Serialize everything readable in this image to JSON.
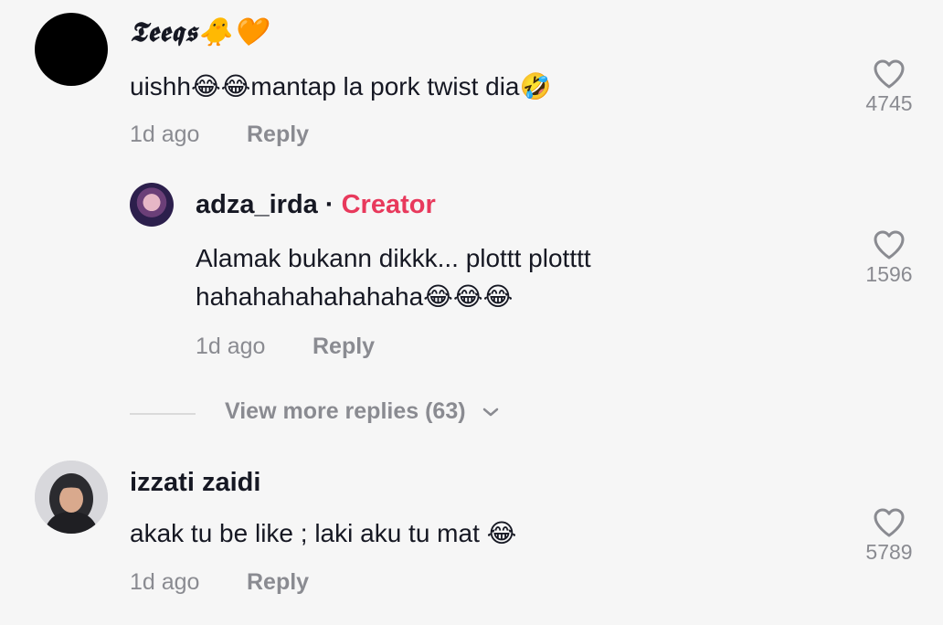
{
  "comments": [
    {
      "username": "𝕿𝖊𝖊𝖖𝖘🐥🧡",
      "text": "uishh😂😂mantap la pork twist dia🤣",
      "time": "1d ago",
      "reply": "Reply",
      "likes": "4745",
      "avatar_icon": "avatar-black"
    },
    {
      "username": "adza_irda",
      "separator": "·",
      "badge": "Creator",
      "text_line1": "Alamak bukann dikkk... plottt plotttt",
      "text_line2": "hahahahahahahaha😂😂😂",
      "time": "1d ago",
      "reply": "Reply",
      "likes": "1596",
      "avatar_icon": "avatar-adza"
    },
    {
      "username": "izzati zaidi",
      "text": "akak tu be like ; laki aku tu mat 😂",
      "time": "1d ago",
      "reply": "Reply",
      "likes": "5789",
      "avatar_icon": "avatar-izzati"
    }
  ],
  "view_more": "View more replies (63)",
  "colors": {
    "background": "#f6f6f6",
    "creator": "#e8395c",
    "muted": "#8a8b91",
    "text": "#161823"
  }
}
